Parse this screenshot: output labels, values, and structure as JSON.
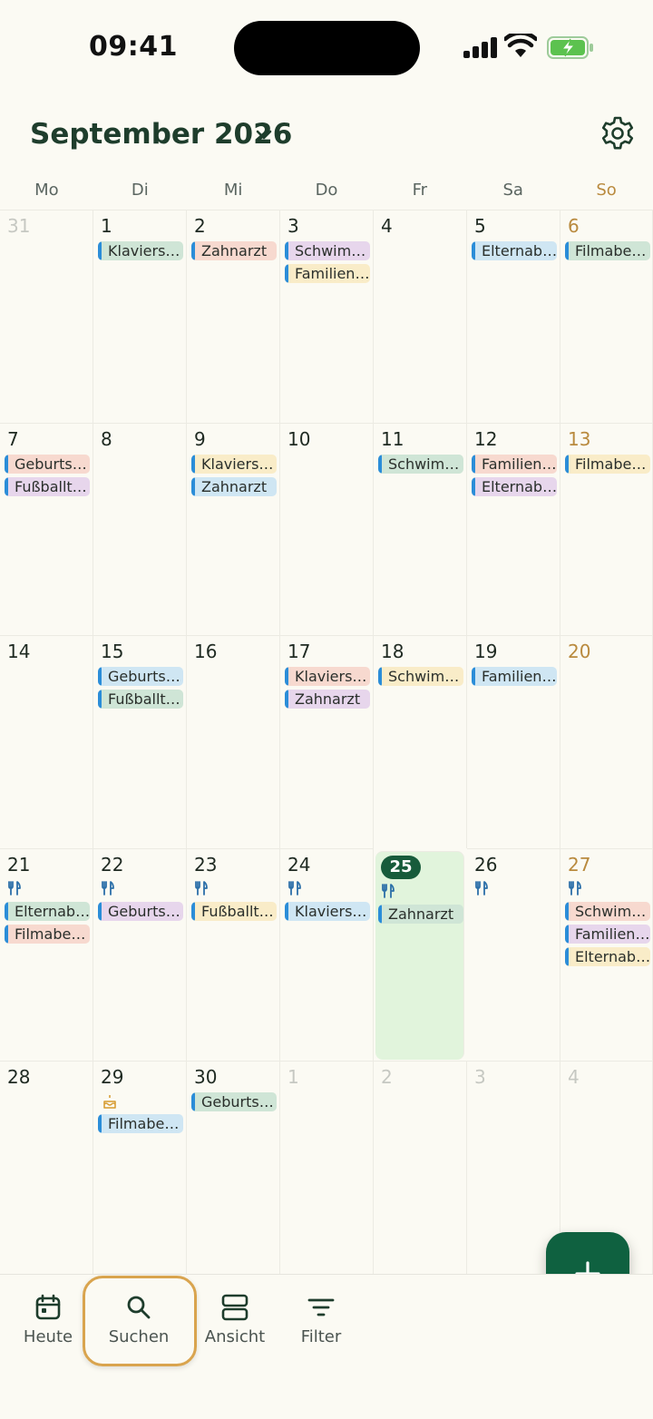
{
  "status_bar": {
    "time": "09:41"
  },
  "header": {
    "month_title": "September 2026"
  },
  "weekdays": [
    "Mo",
    "Di",
    "Mi",
    "Do",
    "Fr",
    "Sa",
    "So"
  ],
  "colors": {
    "accent": "#175b3b",
    "today_bg": "#e1f4dc",
    "sunday": "#b98a3e",
    "event_bar": "#2b8dd8",
    "highlight": "#d9a44e"
  },
  "weeks": [
    [
      {
        "day": "31",
        "out": true,
        "events": []
      },
      {
        "day": "1",
        "events": [
          {
            "title": "Klaviers…",
            "color": "green"
          }
        ]
      },
      {
        "day": "2",
        "events": [
          {
            "title": "Zahnarzt",
            "color": "pink"
          }
        ]
      },
      {
        "day": "3",
        "events": [
          {
            "title": "Schwim…",
            "color": "purple"
          },
          {
            "title": "Familien…",
            "color": "yellow"
          }
        ]
      },
      {
        "day": "4",
        "events": []
      },
      {
        "day": "5",
        "events": [
          {
            "title": "Elternab…",
            "color": "blue"
          }
        ]
      },
      {
        "day": "6",
        "sun": true,
        "events": [
          {
            "title": "Filmabe…",
            "color": "green"
          }
        ]
      }
    ],
    [
      {
        "day": "7",
        "events": [
          {
            "title": "Geburts…",
            "color": "pink"
          },
          {
            "title": "Fußballt…",
            "color": "purple"
          }
        ]
      },
      {
        "day": "8",
        "events": []
      },
      {
        "day": "9",
        "events": [
          {
            "title": "Klaviers…",
            "color": "yellow"
          },
          {
            "title": "Zahnarzt",
            "color": "blue"
          }
        ]
      },
      {
        "day": "10",
        "events": []
      },
      {
        "day": "11",
        "events": [
          {
            "title": "Schwim…",
            "color": "green"
          }
        ]
      },
      {
        "day": "12",
        "events": [
          {
            "title": "Familien…",
            "color": "pink"
          },
          {
            "title": "Elternab…",
            "color": "purple"
          }
        ]
      },
      {
        "day": "13",
        "sun": true,
        "events": [
          {
            "title": "Filmabe…",
            "color": "yellow"
          }
        ]
      }
    ],
    [
      {
        "day": "14",
        "events": []
      },
      {
        "day": "15",
        "events": [
          {
            "title": "Geburts…",
            "color": "blue"
          },
          {
            "title": "Fußballt…",
            "color": "green"
          }
        ]
      },
      {
        "day": "16",
        "events": []
      },
      {
        "day": "17",
        "events": [
          {
            "title": "Klaviers…",
            "color": "pink"
          },
          {
            "title": "Zahnarzt",
            "color": "purple"
          }
        ]
      },
      {
        "day": "18",
        "events": [
          {
            "title": "Schwim…",
            "color": "yellow"
          }
        ]
      },
      {
        "day": "19",
        "events": [
          {
            "title": "Familien…",
            "color": "blue"
          }
        ]
      },
      {
        "day": "20",
        "sun": true,
        "events": []
      }
    ],
    [
      {
        "day": "21",
        "meal": true,
        "events": [
          {
            "title": "Elternab…",
            "color": "green"
          },
          {
            "title": "Filmabe…",
            "color": "pink"
          }
        ]
      },
      {
        "day": "22",
        "meal": true,
        "events": [
          {
            "title": "Geburts…",
            "color": "purple"
          }
        ]
      },
      {
        "day": "23",
        "meal": true,
        "events": [
          {
            "title": "Fußballt…",
            "color": "yellow"
          }
        ]
      },
      {
        "day": "24",
        "meal": true,
        "events": [
          {
            "title": "Klaviers…",
            "color": "blue"
          }
        ]
      },
      {
        "day": "25",
        "today": true,
        "meal": true,
        "events": [
          {
            "title": "Zahnarzt",
            "color": "green"
          }
        ]
      },
      {
        "day": "26",
        "meal": true,
        "events": []
      },
      {
        "day": "27",
        "sun": true,
        "meal": true,
        "events": [
          {
            "title": "Schwim…",
            "color": "pink"
          },
          {
            "title": "Familien…",
            "color": "purple"
          },
          {
            "title": "Elternab…",
            "color": "yellow"
          }
        ]
      }
    ],
    [
      {
        "day": "28",
        "events": []
      },
      {
        "day": "29",
        "cake": true,
        "events": [
          {
            "title": "Filmabe…",
            "color": "blue"
          }
        ]
      },
      {
        "day": "30",
        "events": [
          {
            "title": "Geburts…",
            "color": "green"
          }
        ]
      },
      {
        "day": "1",
        "out": true,
        "events": []
      },
      {
        "day": "2",
        "out": true,
        "events": []
      },
      {
        "day": "3",
        "out": true,
        "events": []
      },
      {
        "day": "4",
        "out": true,
        "events": []
      }
    ]
  ],
  "nav": {
    "today_label": "Heute",
    "search_label": "Suchen",
    "view_label": "Ansicht",
    "filter_label": "Filter"
  }
}
